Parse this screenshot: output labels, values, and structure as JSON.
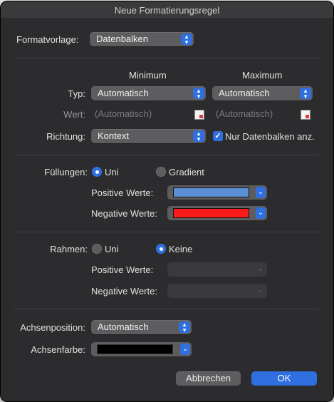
{
  "dialog": {
    "title": "Neue Formatierungsregel"
  },
  "format": {
    "label": "Formatvorlage:",
    "value": "Datenbalken"
  },
  "columns": {
    "min": "Minimum",
    "max": "Maximum"
  },
  "typ": {
    "label": "Typ:",
    "min_value": "Automatisch",
    "max_value": "Automatisch"
  },
  "wert": {
    "label": "Wert:",
    "min_placeholder": "(Automatisch)",
    "max_placeholder": "(Automatisch)"
  },
  "richtung": {
    "label": "Richtung:",
    "value": "Kontext",
    "checkbox_label": "Nur Datenbalken anz.",
    "checkbox_checked": true
  },
  "fill": {
    "label": "Füllungen:",
    "option1": "Uni",
    "option2": "Gradient",
    "selected": "Uni",
    "positive_label": "Positive Werte:",
    "positive_color": "#5b8fd4",
    "negative_label": "Negative Werte:",
    "negative_color": "#ff1a1a"
  },
  "border": {
    "label": "Rahmen:",
    "option1": "Uni",
    "option2": "Keine",
    "selected": "Keine",
    "positive_label": "Positive Werte:",
    "negative_label": "Negative Werte:"
  },
  "axis": {
    "position_label": "Achsenposition:",
    "position_value": "Automatisch",
    "color_label": "Achsenfarbe:",
    "color": "#000000"
  },
  "buttons": {
    "cancel": "Abbrechen",
    "ok": "OK"
  }
}
